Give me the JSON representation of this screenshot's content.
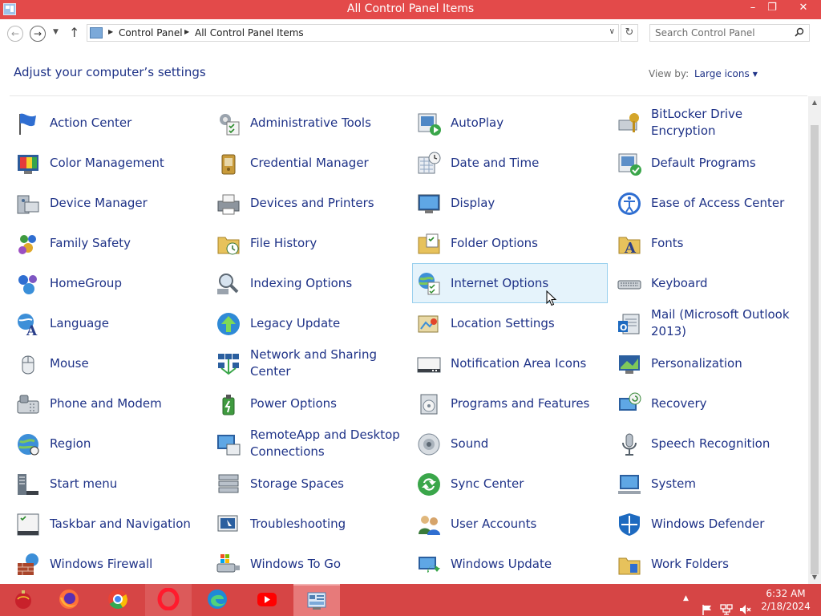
{
  "window": {
    "title": "All Control Panel Items",
    "minimize_glyph": "–",
    "restore_glyph": "❐",
    "close_glyph": "✕"
  },
  "nav": {
    "breadcrumb": [
      "Control Panel",
      "All Control Panel Items"
    ],
    "search_placeholder": "Search Control Panel"
  },
  "header": {
    "title": "Adjust your computer’s settings",
    "view_by_label": "View by:",
    "view_by_value": "Large icons"
  },
  "items": [
    {
      "label": "Action Center",
      "icon": "flag-icon"
    },
    {
      "label": "Administrative Tools",
      "icon": "admin-tools-icon"
    },
    {
      "label": "AutoPlay",
      "icon": "autoplay-icon"
    },
    {
      "label": "BitLocker Drive Encryption",
      "icon": "bitlocker-icon"
    },
    {
      "label": "Color Management",
      "icon": "color-management-icon"
    },
    {
      "label": "Credential Manager",
      "icon": "credential-manager-icon"
    },
    {
      "label": "Date and Time",
      "icon": "date-time-icon"
    },
    {
      "label": "Default Programs",
      "icon": "default-programs-icon"
    },
    {
      "label": "Device Manager",
      "icon": "device-manager-icon"
    },
    {
      "label": "Devices and Printers",
      "icon": "printer-icon"
    },
    {
      "label": "Display",
      "icon": "display-icon"
    },
    {
      "label": "Ease of Access Center",
      "icon": "ease-of-access-icon"
    },
    {
      "label": "Family Safety",
      "icon": "family-safety-icon"
    },
    {
      "label": "File History",
      "icon": "file-history-icon"
    },
    {
      "label": "Folder Options",
      "icon": "folder-options-icon"
    },
    {
      "label": "Fonts",
      "icon": "fonts-icon"
    },
    {
      "label": "HomeGroup",
      "icon": "homegroup-icon"
    },
    {
      "label": "Indexing Options",
      "icon": "indexing-icon"
    },
    {
      "label": "Internet Options",
      "icon": "internet-options-icon",
      "highlighted": true
    },
    {
      "label": "Keyboard",
      "icon": "keyboard-icon"
    },
    {
      "label": "Language",
      "icon": "language-icon"
    },
    {
      "label": "Legacy Update",
      "icon": "legacy-update-icon"
    },
    {
      "label": "Location Settings",
      "icon": "location-icon"
    },
    {
      "label": "Mail (Microsoft Outlook 2013)",
      "icon": "mail-icon"
    },
    {
      "label": "Mouse",
      "icon": "mouse-icon"
    },
    {
      "label": "Network and Sharing Center",
      "icon": "network-icon"
    },
    {
      "label": "Notification Area Icons",
      "icon": "notification-area-icon"
    },
    {
      "label": "Personalization",
      "icon": "personalization-icon"
    },
    {
      "label": "Phone and Modem",
      "icon": "phone-icon"
    },
    {
      "label": "Power Options",
      "icon": "power-icon"
    },
    {
      "label": "Programs and Features",
      "icon": "programs-icon"
    },
    {
      "label": "Recovery",
      "icon": "recovery-icon"
    },
    {
      "label": "Region",
      "icon": "region-icon"
    },
    {
      "label": "RemoteApp and Desktop Connections",
      "icon": "remoteapp-icon"
    },
    {
      "label": "Sound",
      "icon": "sound-icon"
    },
    {
      "label": "Speech Recognition",
      "icon": "microphone-icon"
    },
    {
      "label": "Start menu",
      "icon": "start-menu-icon"
    },
    {
      "label": "Storage Spaces",
      "icon": "storage-spaces-icon"
    },
    {
      "label": "Sync Center",
      "icon": "sync-icon"
    },
    {
      "label": "System",
      "icon": "system-icon"
    },
    {
      "label": "Taskbar and Navigation",
      "icon": "taskbar-icon"
    },
    {
      "label": "Troubleshooting",
      "icon": "troubleshooting-icon"
    },
    {
      "label": "User Accounts",
      "icon": "user-accounts-icon"
    },
    {
      "label": "Windows Defender",
      "icon": "shield-icon"
    },
    {
      "label": "Windows Firewall",
      "icon": "firewall-icon"
    },
    {
      "label": "Windows To Go",
      "icon": "usb-drive-icon"
    },
    {
      "label": "Windows Update",
      "icon": "windows-update-icon"
    },
    {
      "label": "Work Folders",
      "icon": "work-folders-icon"
    }
  ],
  "taskbar": {
    "apps": [
      {
        "name": "ornament-start-icon",
        "color": "#c8212b"
      },
      {
        "name": "firefox-icon",
        "color": "#ff7139"
      },
      {
        "name": "chrome-icon",
        "color": "#34a853"
      },
      {
        "name": "opera-icon",
        "color": "#ff1b2d"
      },
      {
        "name": "edge-icon",
        "color": "#1f8ad6"
      },
      {
        "name": "youtube-icon",
        "color": "#ff0000"
      },
      {
        "name": "control-panel-icon",
        "color": "#7ba9d9"
      }
    ],
    "time": "6:32 AM",
    "date": "2/18/2024"
  },
  "colors": {
    "titlebar": "#e34a4a",
    "taskbar": "#d64545",
    "link": "#1e3287",
    "highlight_bg": "#e5f3fb",
    "highlight_border": "#9ad0ee"
  }
}
